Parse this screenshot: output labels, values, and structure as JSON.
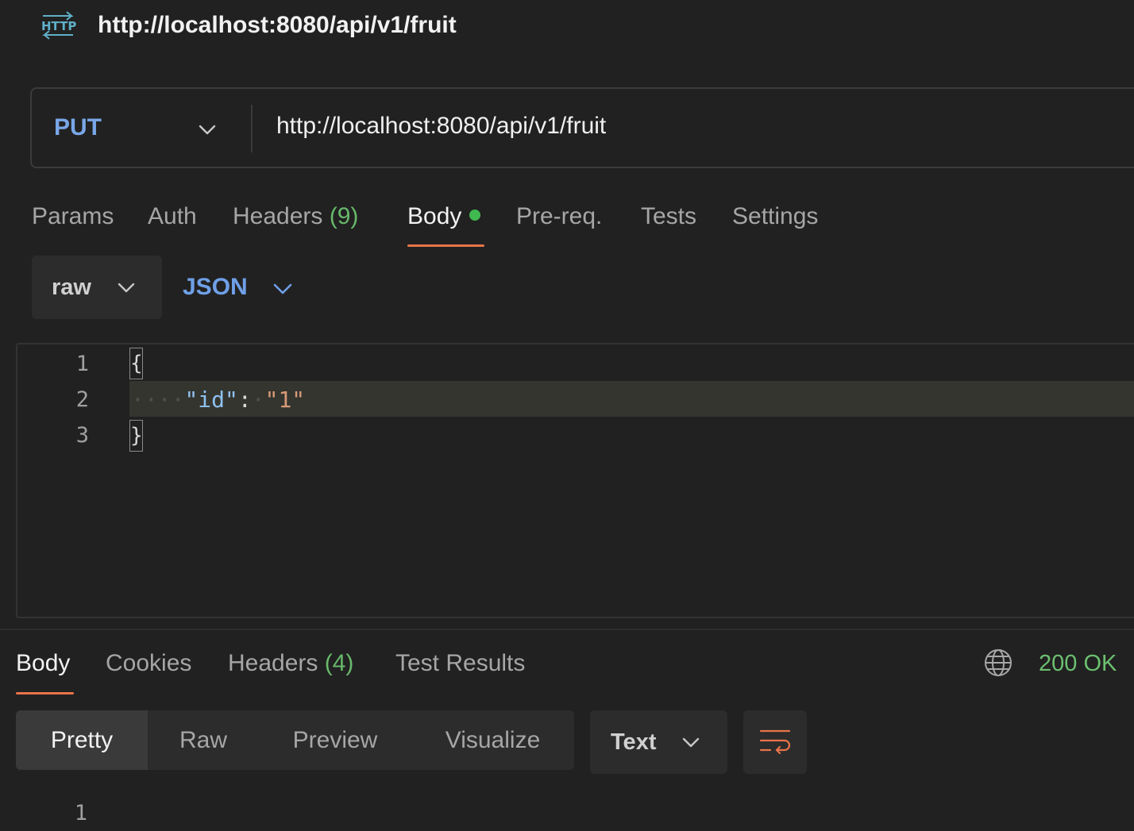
{
  "header": {
    "icon": "http-icon",
    "title": "http://localhost:8080/api/v1/fruit"
  },
  "request": {
    "method": "PUT",
    "url": "http://localhost:8080/api/v1/fruit",
    "tabs": [
      {
        "label": "Params"
      },
      {
        "label": "Auth"
      },
      {
        "label": "Headers",
        "count": "(9)"
      },
      {
        "label": "Body",
        "active": true,
        "indicator": "modified-dot"
      },
      {
        "label": "Pre-req."
      },
      {
        "label": "Tests"
      },
      {
        "label": "Settings"
      }
    ],
    "body_mode": "raw",
    "body_language": "JSON",
    "editor": {
      "line_numbers": [
        "1",
        "2",
        "3"
      ],
      "lines": [
        "{",
        "\"id\": \"1\"",
        "}"
      ],
      "tokens": {
        "key": "\"id\"",
        "colon": ":",
        "value": "\"1\"",
        "open_brace": "{",
        "close_brace": "}"
      }
    }
  },
  "response": {
    "tabs": [
      {
        "label": "Body",
        "active": true
      },
      {
        "label": "Cookies"
      },
      {
        "label": "Headers",
        "count": "(4)"
      },
      {
        "label": "Test Results"
      }
    ],
    "status": "200 OK",
    "views": [
      "Pretty",
      "Raw",
      "Preview",
      "Visualize"
    ],
    "active_view": "Pretty",
    "format": "Text",
    "line_numbers": [
      "1"
    ]
  },
  "colors": {
    "background": "#212121",
    "accent": "#e8744a",
    "method": "#79a7e8",
    "success": "#6cc070",
    "json_key": "#8ec2f0",
    "json_string": "#d99a78"
  }
}
